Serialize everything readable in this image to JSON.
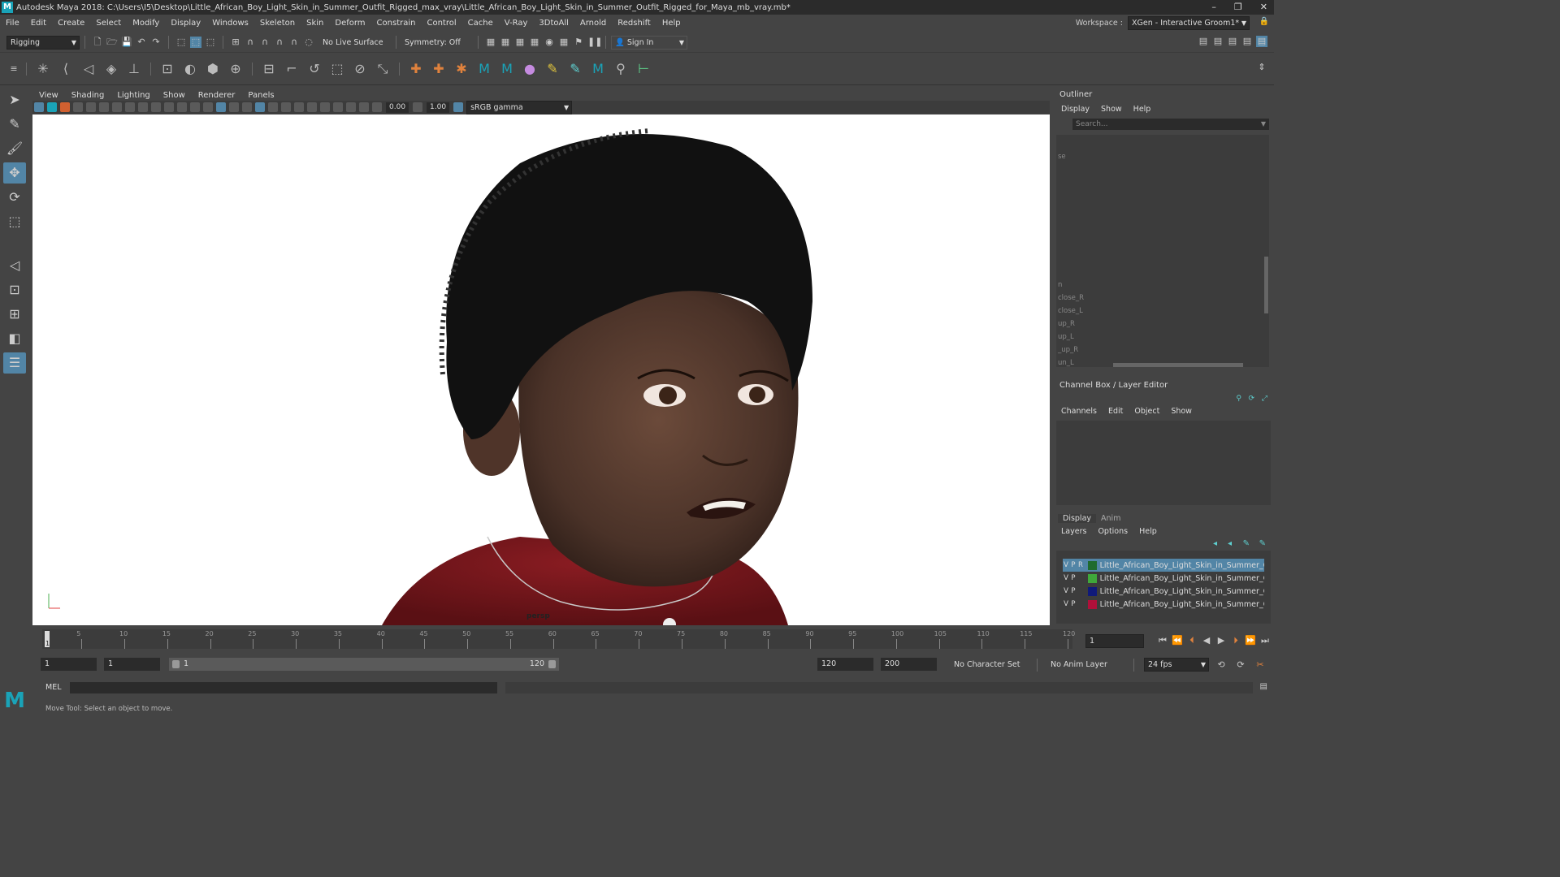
{
  "window": {
    "title": "Autodesk Maya 2018: C:\\Users\\I5\\Desktop\\Little_African_Boy_Light_Skin_in_Summer_Outfit_Rigged_max_vray\\Little_African_Boy_Light_Skin_in_Summer_Outfit_Rigged_for_Maya_mb_vray.mb*",
    "controls": [
      "–",
      "❐",
      "✕"
    ]
  },
  "menubar": {
    "items": [
      "File",
      "Edit",
      "Create",
      "Select",
      "Modify",
      "Display",
      "Windows",
      "Skeleton",
      "Skin",
      "Deform",
      "Constrain",
      "Control",
      "Cache",
      "V-Ray",
      "3DtoAll",
      "Arnold",
      "Redshift",
      "Help"
    ],
    "workspace_label": "Workspace :",
    "workspace_value": "XGen - Interactive Groom1*"
  },
  "statusline": {
    "mode": "Rigging",
    "live_surface": "No Live Surface",
    "symmetry": "Symmetry: Off",
    "sign_in": "Sign In"
  },
  "viewport": {
    "menu": [
      "View",
      "Shading",
      "Lighting",
      "Show",
      "Renderer",
      "Panels"
    ],
    "exposure": "0.00",
    "gamma": "1.00",
    "color_space": "sRGB gamma",
    "camera_label": "persp"
  },
  "outliner": {
    "title": "Outliner",
    "menu": [
      "Display",
      "Show",
      "Help"
    ],
    "search_placeholder": "Search...",
    "items": [
      "se",
      "n",
      "close_R",
      "close_L",
      "up_R",
      "up_L",
      "_up_R",
      "un_L"
    ]
  },
  "channelbox": {
    "title": "Channel Box / Layer Editor",
    "menu": [
      "Channels",
      "Edit",
      "Object",
      "Show"
    ]
  },
  "layereditor": {
    "tabs": [
      "Display",
      "Anim"
    ],
    "menu": [
      "Layers",
      "Options",
      "Help"
    ],
    "layers": [
      {
        "v": "V",
        "p": "P",
        "r": "R",
        "name": "Little_African_Boy_Light_Skin_in_Summer_Outfit",
        "color": "#1f6b2e",
        "selected": true
      },
      {
        "v": "V",
        "p": "P",
        "r": "",
        "name": "Little_African_Boy_Light_Skin_in_Summer_Outfit",
        "color": "#3fa83a",
        "selected": false
      },
      {
        "v": "V",
        "p": "P",
        "r": "",
        "name": "Little_African_Boy_Light_Skin_in_Summer_Outfit",
        "color": "#101a7a",
        "selected": false
      },
      {
        "v": "V",
        "p": "P",
        "r": "",
        "name": "Little_African_Boy_Light_Skin_in_Summer_Outfit",
        "color": "#b0103a",
        "selected": false
      }
    ]
  },
  "timeline": {
    "labels": [
      "5",
      "10",
      "15",
      "20",
      "25",
      "30",
      "35",
      "40",
      "45",
      "50",
      "55",
      "60",
      "65",
      "70",
      "75",
      "80",
      "85",
      "90",
      "95",
      "100",
      "105",
      "110",
      "115",
      "120"
    ],
    "start_label": "1",
    "current_frame": "1"
  },
  "range": {
    "start": "1",
    "playback_start": "1",
    "slider_start": "1",
    "slider_end": "120",
    "playback_end": "120",
    "end": "200",
    "character_set": "No Character Set",
    "anim_layer": "No Anim Layer",
    "fps": "24 fps"
  },
  "commandline": {
    "label": "MEL"
  },
  "helpline": {
    "text": "Move Tool: Select an object to move."
  }
}
